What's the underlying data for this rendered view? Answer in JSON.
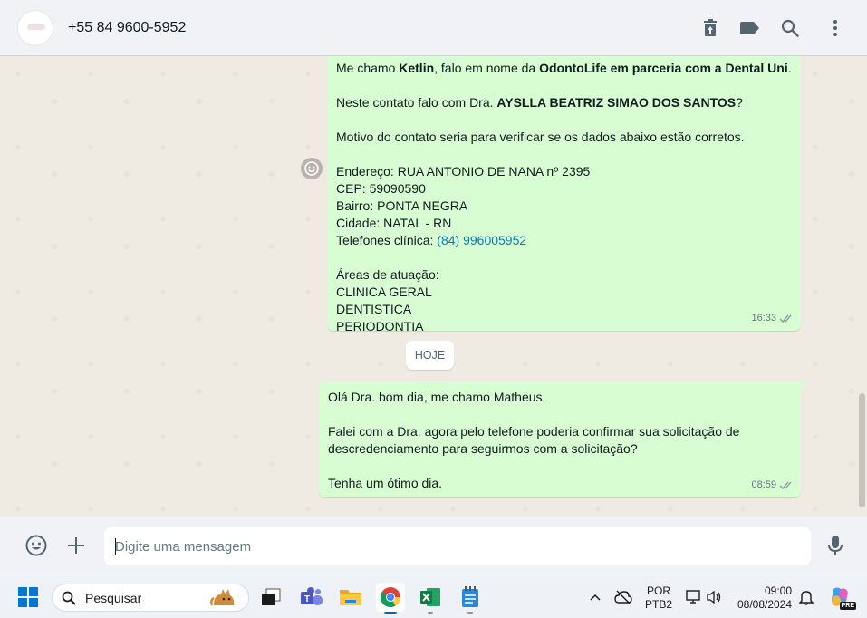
{
  "header": {
    "contact": "+55 84 9600-5952",
    "icons": [
      "delete-icon",
      "label-icon",
      "search-icon",
      "menu-icon"
    ]
  },
  "messages": [
    {
      "direction": "outgoing",
      "lines": [
        [
          {
            "t": "Me chamo "
          },
          {
            "t": "Ketlin",
            "b": true
          },
          {
            "t": ", falo em nome da "
          },
          {
            "t": "OdontoLife em parceria com a Dental Uni",
            "b": true
          },
          {
            "t": "."
          }
        ],
        [],
        [
          {
            "t": "Neste contato falo com Dra. "
          },
          {
            "t": "AYSLLA BEATRIZ SIMAO DOS SANTOS",
            "b": true
          },
          {
            "t": "?"
          }
        ],
        [],
        [
          {
            "t": "Motivo do contato seria para verificar se os dados abaixo estão corretos."
          }
        ],
        [],
        [
          {
            "t": "Endereço: RUA ANTONIO DE NANA nº 2395"
          }
        ],
        [
          {
            "t": "CEP: 59090590"
          }
        ],
        [
          {
            "t": "Bairro: PONTA NEGRA"
          }
        ],
        [
          {
            "t": "Cidade: NATAL - RN"
          }
        ],
        [
          {
            "t": "Telefones clínica: "
          },
          {
            "t": "(84) 996005952",
            "link": true
          }
        ],
        [],
        [
          {
            "t": "Áreas de atuação:"
          }
        ],
        [
          {
            "t": "CLINICA GERAL"
          }
        ],
        [
          {
            "t": "DENTISTICA"
          }
        ],
        [
          {
            "t": "PERIODONTIA"
          }
        ]
      ],
      "time": "16:33"
    },
    {
      "direction": "outgoing",
      "lines": [
        [
          {
            "t": "Olá Dra. bom dia, me chamo Matheus."
          }
        ],
        [],
        [
          {
            "t": "Falei com a Dra. agora pelo telefone poderia confirmar sua solicitação de"
          }
        ],
        [
          {
            "t": "descredenciamento para seguirmos com a solicitação?"
          }
        ],
        [],
        [
          {
            "t": "Tenha um ótimo dia."
          }
        ]
      ],
      "time": "08:59"
    }
  ],
  "date_divider": "HOJE",
  "composer": {
    "placeholder": "Digite uma mensagem"
  },
  "taskbar": {
    "search_label": "Pesquisar",
    "language_line1": "POR",
    "language_line2": "PTB2",
    "time": "09:00",
    "date": "08/08/2024",
    "copilot_badge": "PRE"
  },
  "colors": {
    "bubble": "#d9fdd3",
    "chat_bg": "#efeae2",
    "link": "#027eb5",
    "panel": "#f0f2f5"
  }
}
